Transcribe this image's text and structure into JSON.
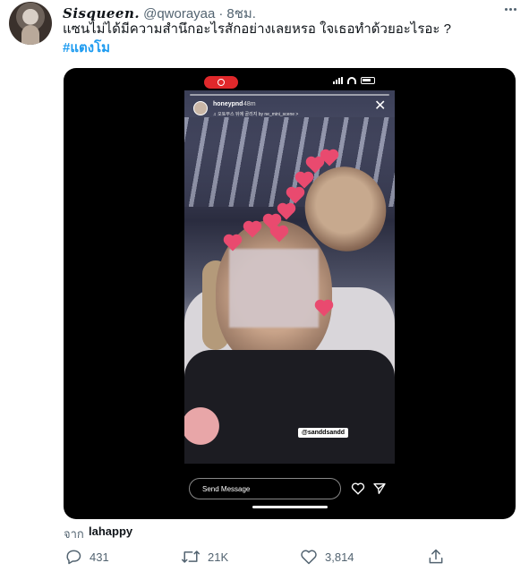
{
  "tweet": {
    "display_name": "Sisqueen.",
    "handle": "@qworayaa",
    "separator": "·",
    "time": "8ชม.",
    "text": "แซนไม่ได้มีความสำนึกอะไรสักอย่างเลยหรอ ใจเธอทำด้วยอะไรอะ ?",
    "hashtag": "#แตงโม"
  },
  "media": {
    "story_user": "honeypnd",
    "story_time": "48m",
    "story_music": "♫ 오토부스 뒤에 골리지 by ne_mini_scene >",
    "mention_sticker": "@sanddsandd",
    "send_message_placeholder": "Send Message",
    "progress": 0.0
  },
  "source": {
    "prefix": "จาก",
    "name": "lahappy"
  },
  "actions": {
    "reply_count": "431",
    "retweet_count": "21K",
    "like_count": "3,814"
  },
  "colors": {
    "link": "#1d9bf0",
    "secondary_text": "#536471",
    "primary_text": "#0f1419",
    "recording_red": "#e0282b",
    "heart_pink": "#e94a6f"
  },
  "icons": [
    "more-icon",
    "reply-icon",
    "retweet-icon",
    "like-icon",
    "share-icon",
    "close-icon",
    "heart-icon",
    "send-icon"
  ]
}
